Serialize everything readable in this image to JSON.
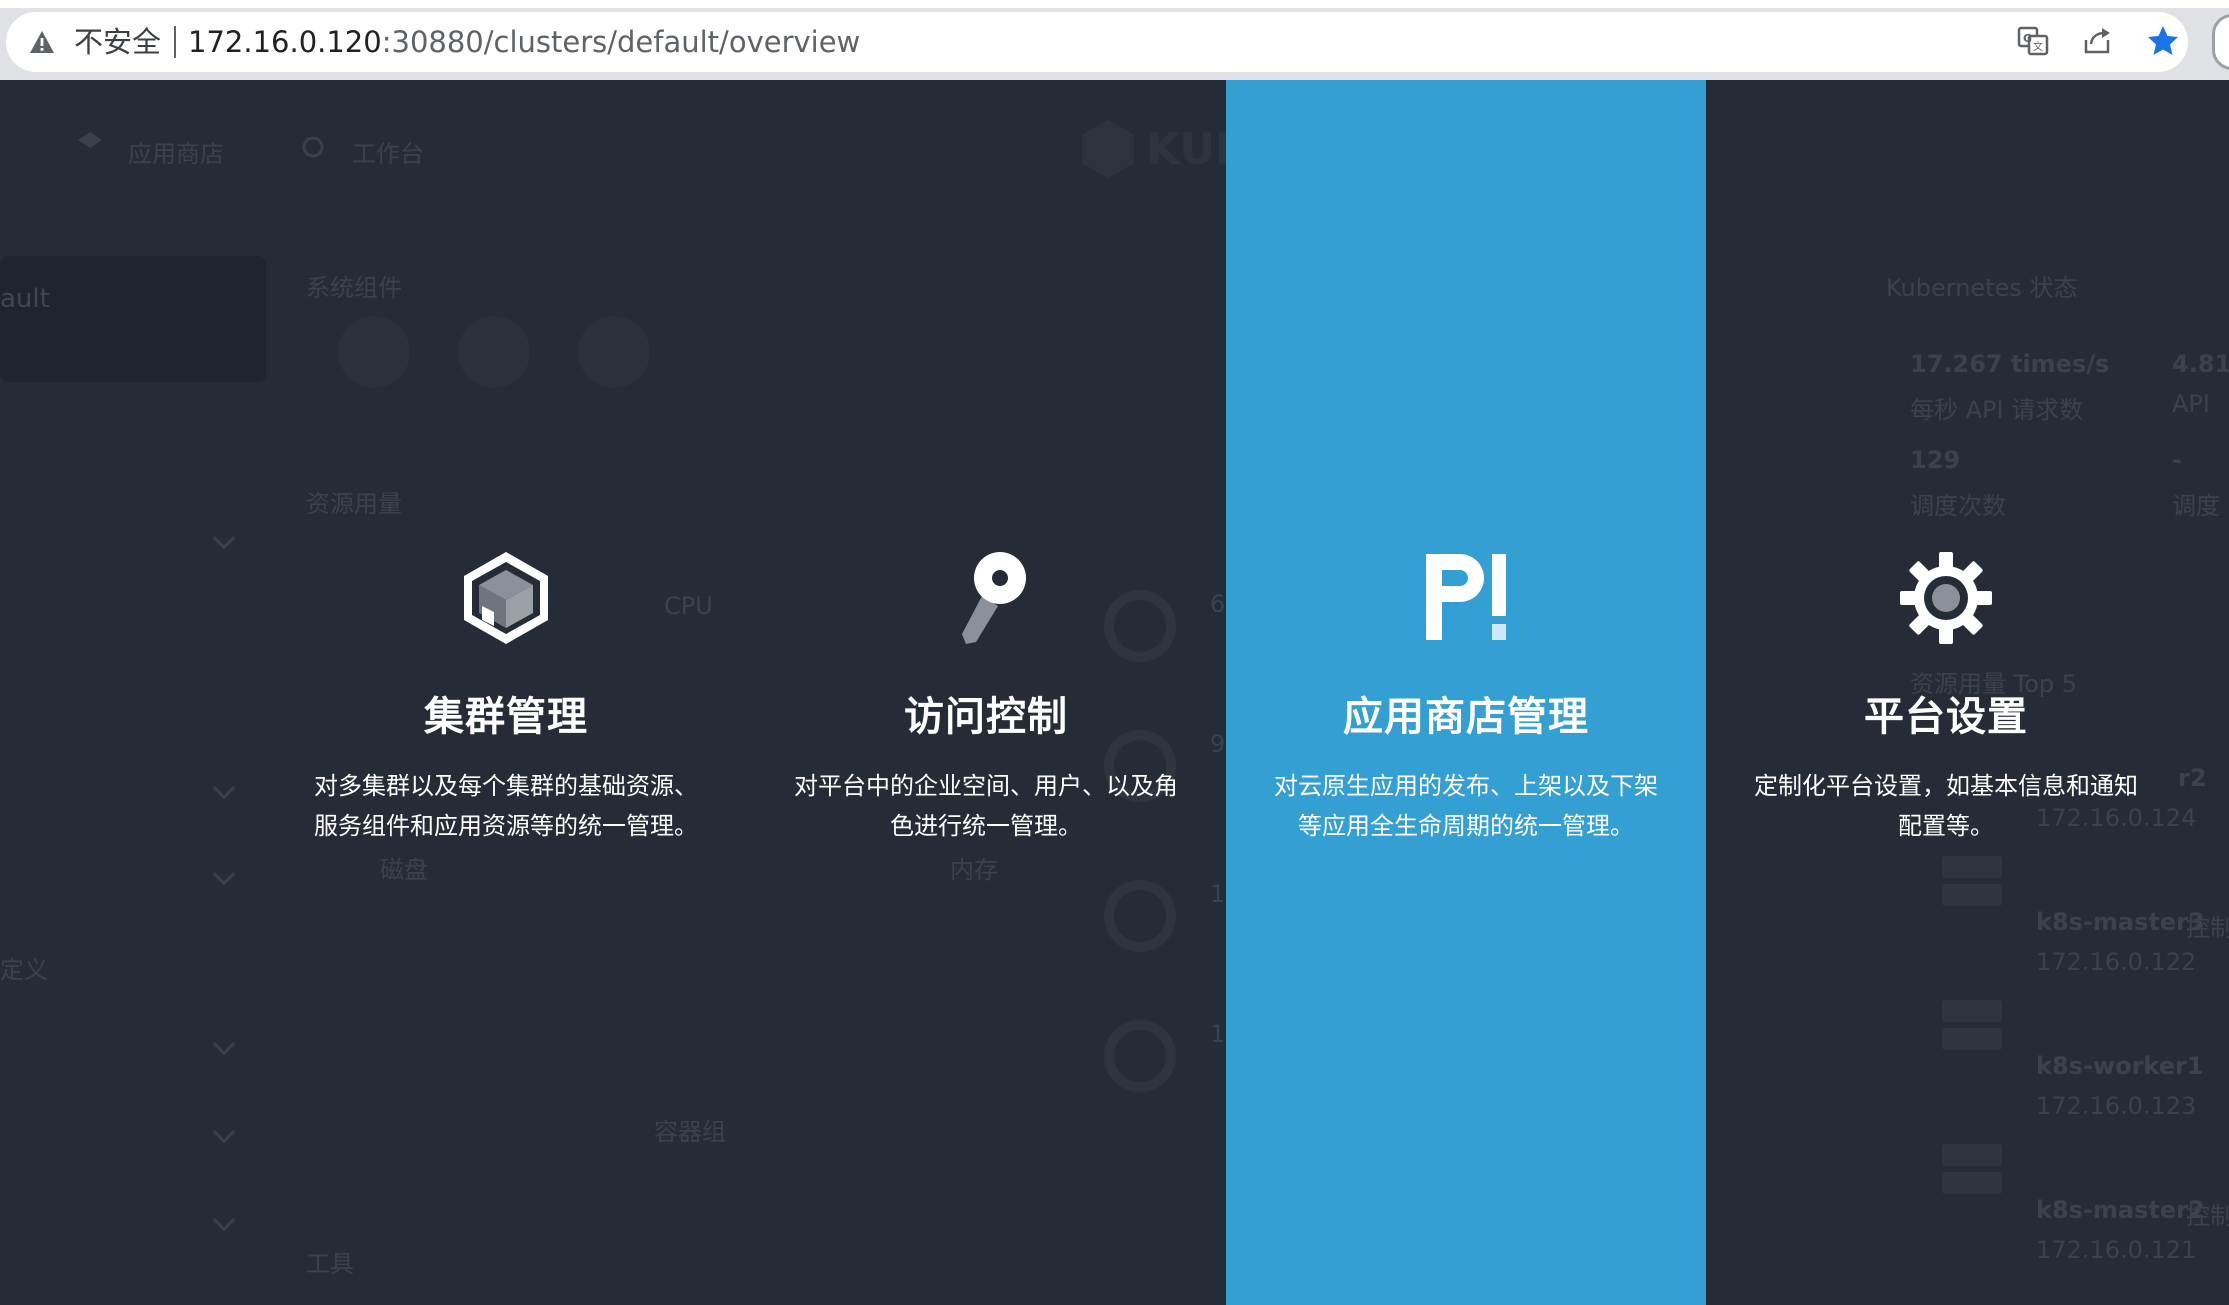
{
  "browser": {
    "security_label": "不安全",
    "url_host": "172.16.0.120",
    "url_rest": ":30880/clusters/default/overview"
  },
  "background": {
    "nav_app_store": "应用商店",
    "nav_workbench": "工作台",
    "logo_text": "KUBE",
    "cluster_name_partial": "ault",
    "system_components": "系统组件",
    "resource_usage": "资源用量",
    "cpu": "CPU",
    "disk": "磁盘",
    "memory": "内存",
    "pods": "容器组",
    "tools": "工具",
    "custom_partial": "定义",
    "k8s_status": "Kubernetes 状态",
    "api_rate": "17.267 times/s",
    "api_rate_label": "每秒 API 请求数",
    "api_rate2": "4.81",
    "api_rate2_label": "API",
    "sched_count": "129",
    "sched_label": "调度次数",
    "sched_dash": "-",
    "sched_label2": "调度",
    "top5": "资源用量 Top 5",
    "node_1_name": "r2",
    "node_1_ip": "172.16.0.124",
    "node_2_name": "k8s-master3",
    "node_2_ip": "172.16.0.122",
    "node_2_badge": "控制",
    "node_3_name": "k8s-worker1",
    "node_3_ip": "172.16.0.123",
    "node_4_name": "k8s-master2",
    "node_4_ip": "172.16.0.121",
    "node_4_badge": "控制",
    "val_1": "6",
    "val_2": "9",
    "val_3": "1",
    "val_4": "1"
  },
  "menu": {
    "cards": [
      {
        "title": "集群管理",
        "desc_line1": "对多集群以及每个集群的基础资源、",
        "desc_line2": "服务组件和应用资源等的统一管理。"
      },
      {
        "title": "访问控制",
        "desc_line1": "对平台中的企业空间、用户、以及角",
        "desc_line2": "色进行统一管理。"
      },
      {
        "title": "应用商店管理",
        "desc_line1": "对云原生应用的发布、上架以及下架",
        "desc_line2": "等应用全生命周期的统一管理。"
      },
      {
        "title": "平台设置",
        "desc_line1": "定制化平台设置，如基本信息和通知",
        "desc_line2": "配置等。"
      }
    ]
  },
  "colors": {
    "overlay_bg": "#262c37",
    "highlight": "#349fd2",
    "card_text": "#ffffff"
  }
}
